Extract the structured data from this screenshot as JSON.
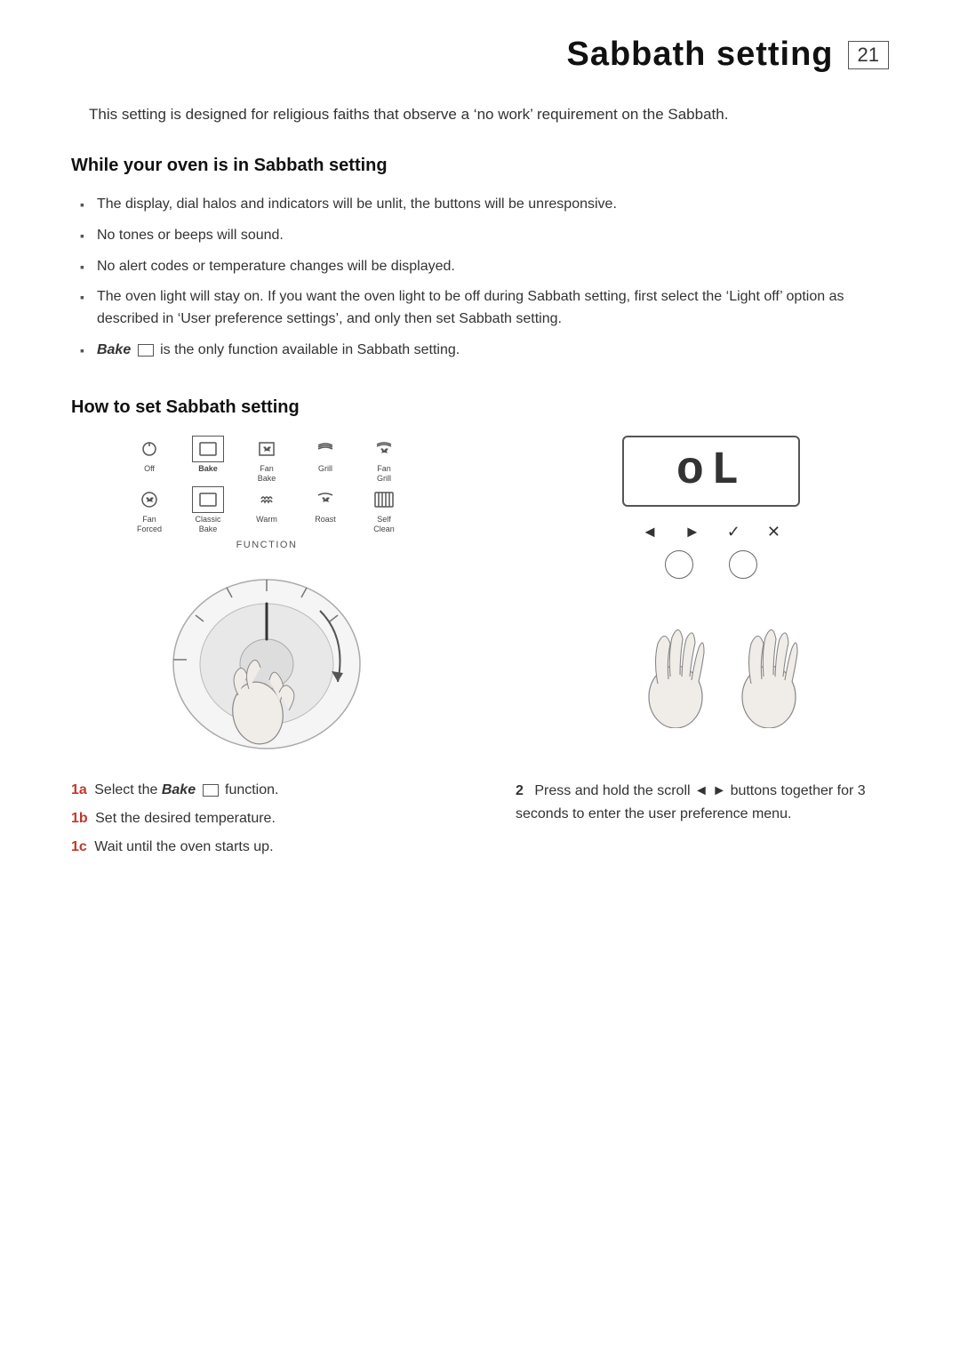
{
  "header": {
    "title": "Sabbath setting",
    "page_number": "21"
  },
  "intro": {
    "text": "This setting is designed for religious faiths that observe a ‘no work’ requirement on the Sabbath."
  },
  "section1": {
    "title": "While your oven is in Sabbath setting",
    "bullets": [
      "The display, dial halos and indicators will be unlit, the buttons will be unresponsive.",
      "No tones or beeps will sound.",
      "No alert codes or temperature changes will be displayed.",
      "The oven light will stay on. If you want the oven light to be off during Sabbath setting, first select the ‘Light off’ option as described in ‘User preference settings’, and only then set Sabbath setting.",
      "Bake is the only function available in Sabbath setting."
    ]
  },
  "section2": {
    "title": "How to set Sabbath setting"
  },
  "function_grid": {
    "label": "FUNCTION",
    "row1": [
      {
        "label": "Off",
        "bold": false
      },
      {
        "label": "Bake",
        "bold": true
      },
      {
        "label": "Fan\nBake",
        "bold": false
      },
      {
        "label": "Grill",
        "bold": false
      },
      {
        "label": "Fan\nGrill",
        "bold": false
      }
    ],
    "row2": [
      {
        "label": "Fan\nForced",
        "bold": false
      },
      {
        "label": "Classic\nBake",
        "bold": false
      },
      {
        "label": "Warm",
        "bold": false
      },
      {
        "label": "Roast",
        "bold": false
      },
      {
        "label": "Self\nClean",
        "bold": false
      }
    ]
  },
  "display": {
    "text": "oL"
  },
  "steps": {
    "left": [
      {
        "num": "1a",
        "text": "Select the Bake function."
      },
      {
        "num": "1b",
        "text": "Set the desired temperature."
      },
      {
        "num": "1c",
        "text": "Wait until the oven starts up."
      }
    ],
    "right": {
      "num": "2",
      "text": "Press and hold the scroll ◄ ► buttons together for 3 seconds to enter the user preference menu."
    }
  }
}
